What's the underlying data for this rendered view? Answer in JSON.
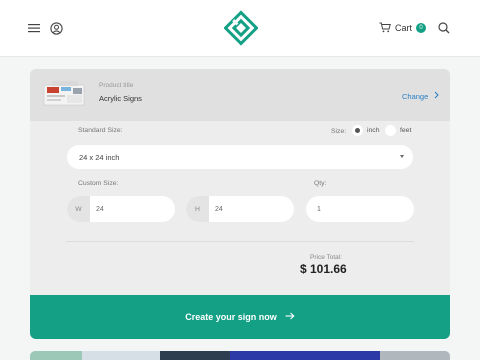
{
  "header": {
    "menu_icon": "menu-icon",
    "account_icon": "account-circle-icon",
    "logo_icon": "brand-logo-icon",
    "cart_label": "Cart",
    "cart_count": "0",
    "search_icon": "search-icon"
  },
  "product": {
    "caption": "Product title",
    "name": "Acrylic Signs",
    "change_label": "Change"
  },
  "form": {
    "standard_size_label": "Standard Size:",
    "size_label": "Size:",
    "unit_options": [
      {
        "label": "inch",
        "selected": true
      },
      {
        "label": "feet",
        "selected": false
      }
    ],
    "standard_size_value": "24 x 24 inch",
    "custom_size_label": "Custom Size:",
    "qty_label": "Qty:",
    "width_prefix": "W",
    "width_value": "24",
    "height_prefix": "H",
    "height_value": "24",
    "qty_value": "1"
  },
  "pricing": {
    "label": "Price Total:",
    "value": "$ 101.66"
  },
  "cta": {
    "label": "Create your sign now"
  },
  "colors": {
    "accent": "#14a085",
    "link": "#2a7fc4"
  }
}
